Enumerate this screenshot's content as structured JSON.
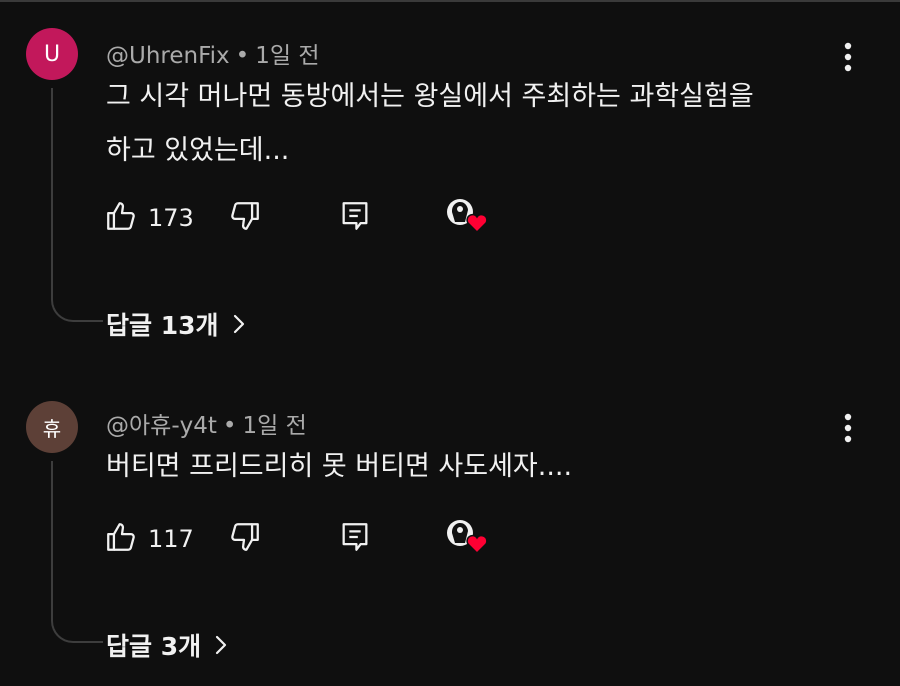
{
  "comments": [
    {
      "avatar_letter": "U",
      "avatar_color": "#c2185b",
      "author": "@UhrenFix",
      "time": "1일 전",
      "text": "그 시각 머나먼 동방에서는 왕실에서 주최하는 과학실험을\n하고 있었는데...",
      "likes": "173",
      "replies_label": "답글 13개"
    },
    {
      "avatar_letter": "휴",
      "avatar_color": "#5d4037",
      "author": "@아휴-y4t",
      "time": "1일 전",
      "text": "버티면 프리드리히 못 버티면 사도세자....",
      "likes": "117",
      "replies_label": "답글 3개"
    }
  ],
  "separator": "•",
  "icons": {
    "like": "thumbs-up-icon",
    "dislike": "thumbs-down-icon",
    "reply": "reply-icon",
    "creator_heart": "creator-heart-icon",
    "more": "more-vert-icon",
    "chevron": "chevron-right-icon"
  },
  "colors": {
    "background": "#0f0f0f",
    "text_primary": "#f1f1f1",
    "text_secondary": "#aaaaaa",
    "heart": "#ff0033"
  }
}
